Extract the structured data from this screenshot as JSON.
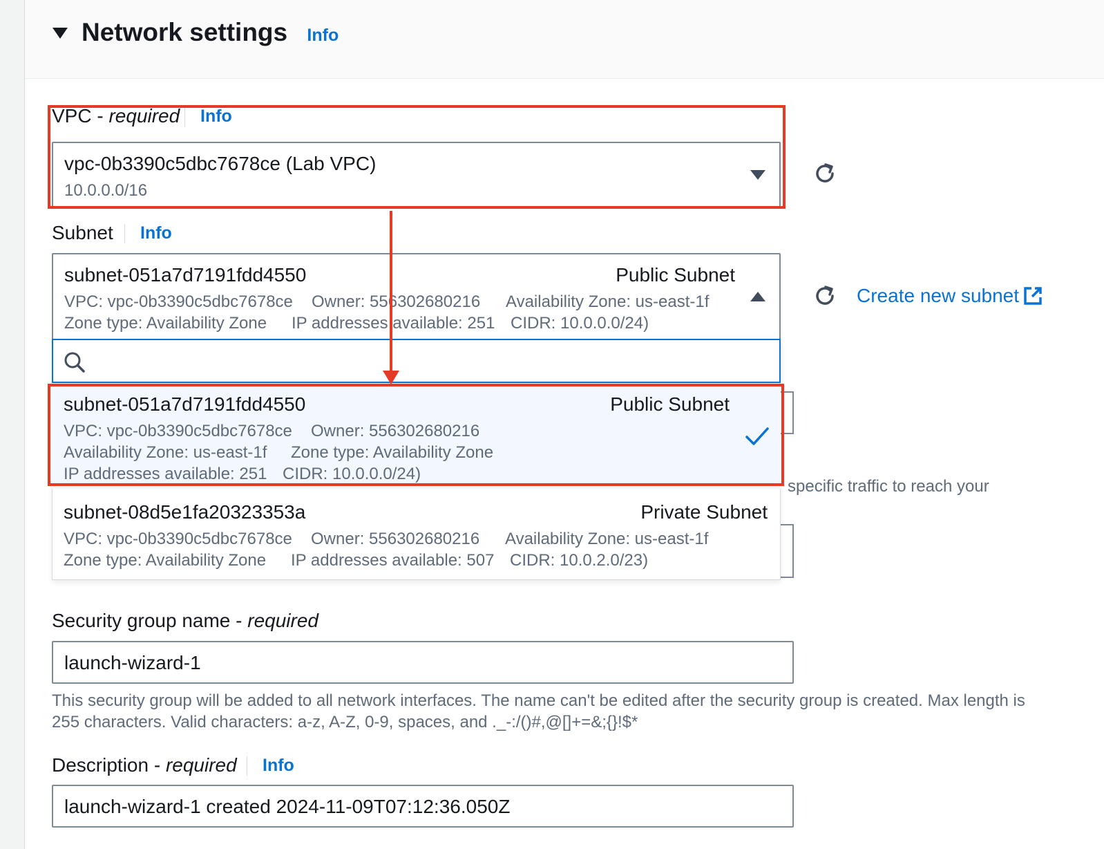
{
  "section": {
    "title": "Network settings",
    "info": "Info"
  },
  "vpc": {
    "label": "VPC - ",
    "required": "required",
    "info": "Info",
    "value": "vpc-0b3390c5dbc7678ce (Lab VPC)",
    "cidr": "10.0.0.0/16"
  },
  "subnet": {
    "label": "Subnet",
    "info": "Info",
    "selected": {
      "id": "subnet-051a7d7191fdd4550",
      "name": "Public Subnet",
      "vpc": "VPC: vpc-0b3390c5dbc7678ce",
      "owner": "Owner: 556302680216",
      "az": "Availability Zone: us-east-1f",
      "zone_type": "Zone type: Availability Zone",
      "ips": "IP addresses available: 251",
      "cidr": "CIDR: 10.0.0.0/24)"
    },
    "create_link": "Create new subnet",
    "search_placeholder": "",
    "options": [
      {
        "id": "subnet-051a7d7191fdd4550",
        "name": "Public Subnet",
        "vpc": "VPC: vpc-0b3390c5dbc7678ce",
        "owner": "Owner: 556302680216",
        "az": "Availability Zone: us-east-1f",
        "zone_type": "Zone type: Availability Zone",
        "ips": "IP addresses available: 251",
        "cidr": "CIDR: 10.0.0.0/24)"
      },
      {
        "id": "subnet-08d5e1fa20323353a",
        "name": "Private Subnet",
        "vpc": "VPC: vpc-0b3390c5dbc7678ce",
        "owner": "Owner: 556302680216",
        "az": "Availability Zone: us-east-1f",
        "zone_type": "Zone type: Availability Zone",
        "ips": "IP addresses available: 507",
        "cidr": "CIDR: 10.0.2.0/23)"
      }
    ]
  },
  "partial_text": "specific traffic to reach your",
  "security_group": {
    "label": "Security group name - ",
    "required": "required",
    "value": "launch-wizard-1",
    "help_line1": "This security group will be added to all network interfaces. The name can't be edited after the security group is created. Max length is",
    "help_line2": "255 characters. Valid characters: a-z, A-Z, 0-9, spaces, and ._-:/()#,@[]+=&;{}!$*"
  },
  "description": {
    "label": "Description - ",
    "required": "required",
    "info": "Info",
    "value": "launch-wizard-1 created 2024-11-09T07:12:36.050Z"
  },
  "colors": {
    "link": "#0972d3",
    "highlight": "#e53a26",
    "selected_bg": "#f2f8fd"
  }
}
